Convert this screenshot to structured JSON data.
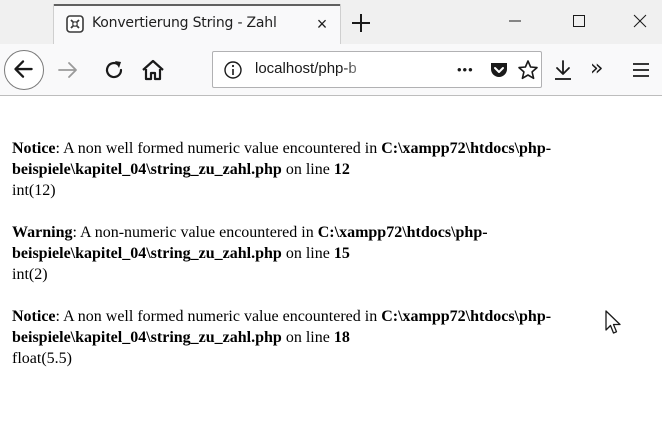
{
  "browser": {
    "tab_title": "Konvertierung String - Zahl",
    "tab_close": "×",
    "url_visible": "localhost/php-b",
    "url_faded": "",
    "page_actions": "•••",
    "overflow": "»"
  },
  "icons": {
    "favicon": "xampp-icon",
    "new_tab": "plus-icon",
    "minimize": "minimize-icon",
    "maximize": "maximize-icon",
    "close": "close-icon",
    "back": "back-arrow-icon",
    "forward": "forward-arrow-icon",
    "reload": "reload-icon",
    "home": "home-icon",
    "info": "info-icon",
    "pocket": "pocket-icon",
    "bookmark": "star-icon",
    "download": "download-icon",
    "menu": "hamburger-menu-icon"
  },
  "messages": [
    {
      "level": "Notice",
      "text": ": A non well formed numeric value encountered in ",
      "file": "C:\\xampp72\\htdocs\\php-beispiele\\kapitel_04\\string_zu_zahl.php",
      "line_prefix": " on line ",
      "line": "12",
      "output": "int(12)"
    },
    {
      "level": "Warning",
      "text": ": A non-numeric value encountered in ",
      "file": "C:\\xampp72\\htdocs\\php-beispiele\\kapitel_04\\string_zu_zahl.php",
      "line_prefix": " on line ",
      "line": "15",
      "output": "int(2)"
    },
    {
      "level": "Notice",
      "text": ": A non well formed numeric value encountered in ",
      "file": "C:\\xampp72\\htdocs\\php-beispiele\\kapitel_04\\string_zu_zahl.php",
      "line_prefix": " on line ",
      "line": "18",
      "output": "float(5.5)"
    }
  ]
}
